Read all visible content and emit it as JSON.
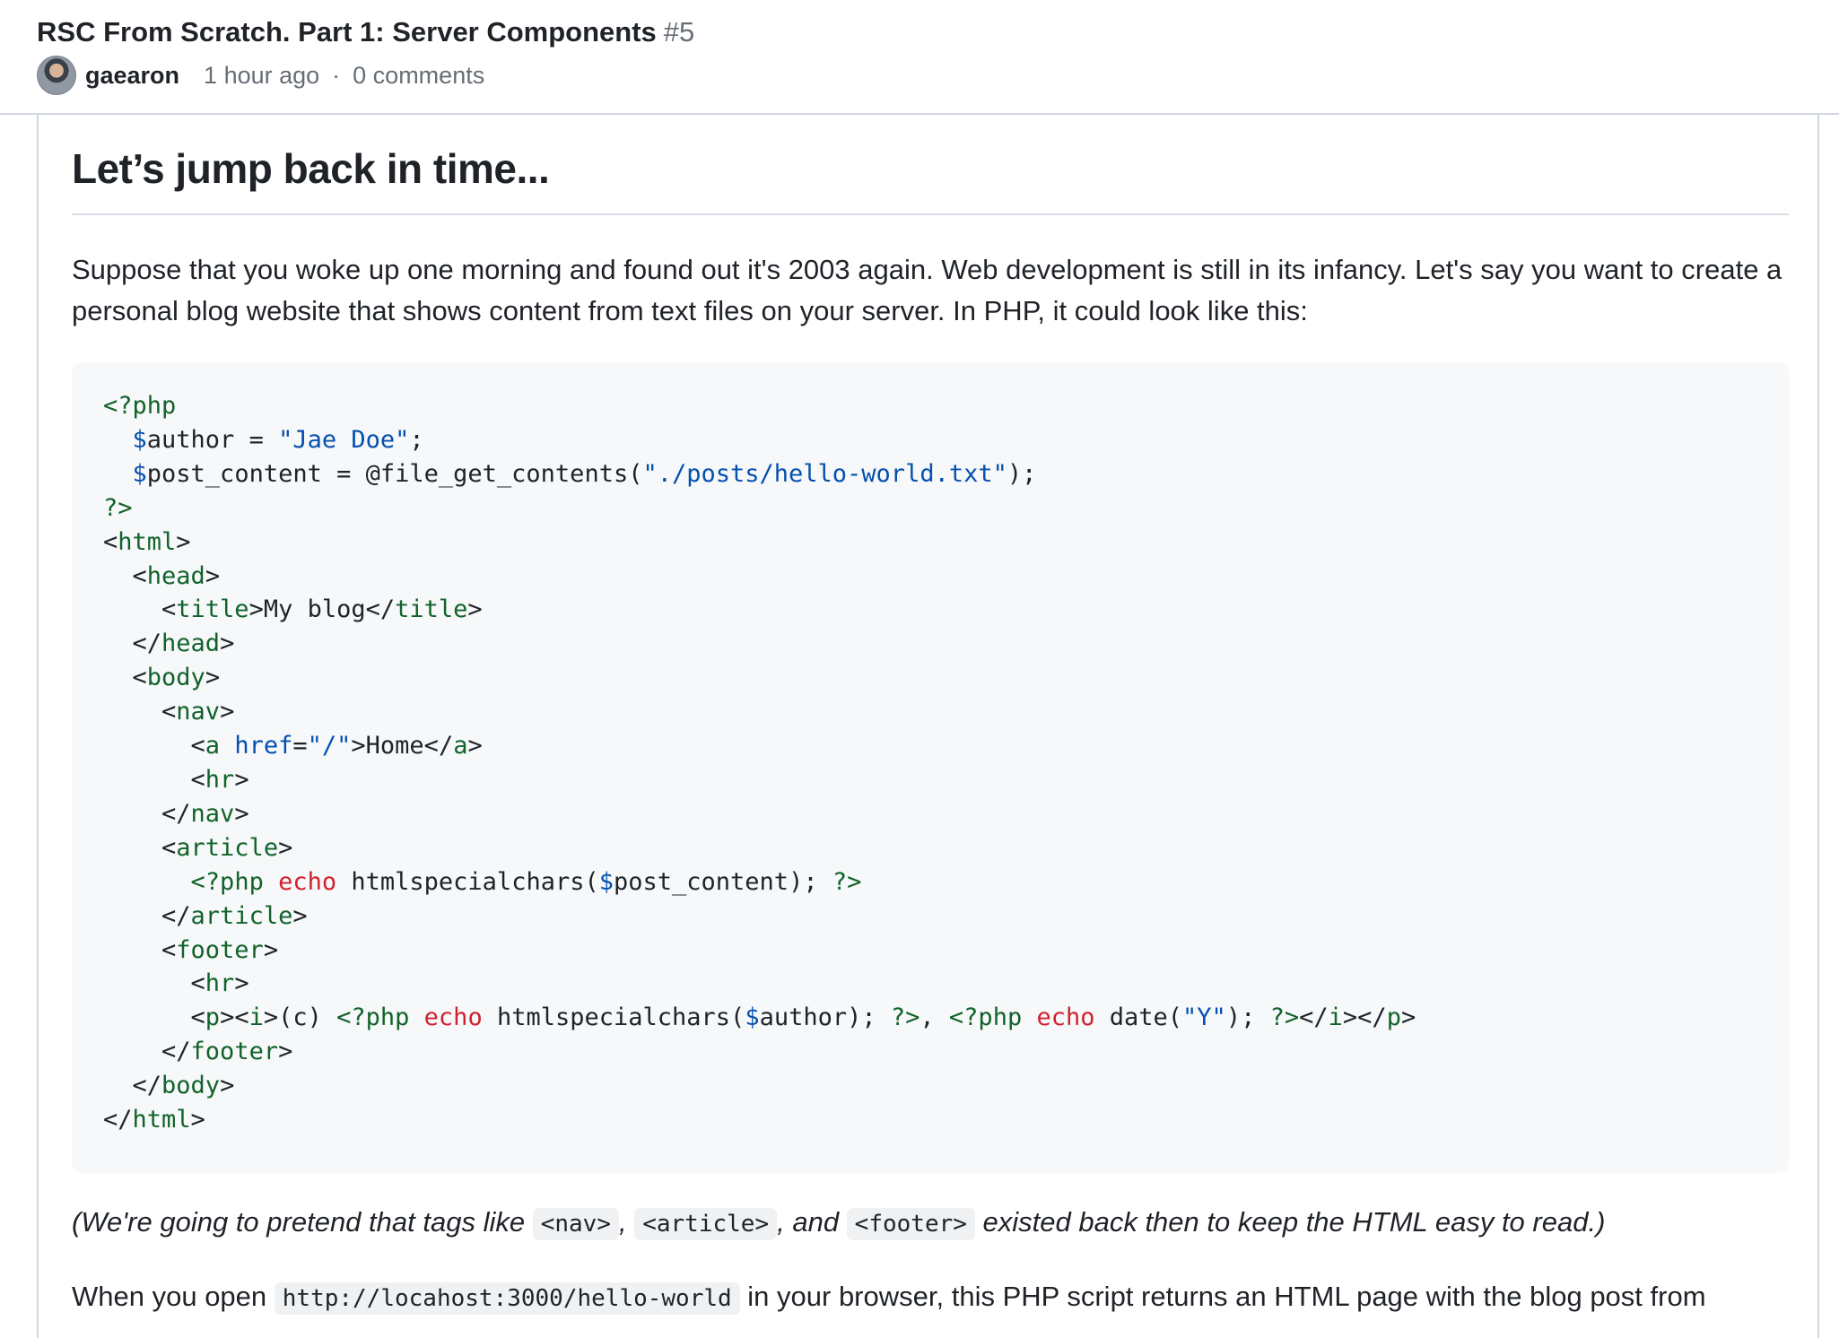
{
  "discussion": {
    "title": "RSC From Scratch. Part 1: Server Components",
    "number": "#5",
    "author": "gaearon",
    "time": "1 hour ago",
    "separator": "·",
    "comments": "0 comments"
  },
  "article": {
    "heading": "Let’s jump back in time...",
    "intro": "Suppose that you woke up one morning and found out it's 2003 again. Web development is still in its infancy. Let's say you want to create a personal blog website that shows content from text files on your server. In PHP, it could look like this:",
    "code_language": "php",
    "note": {
      "before": "(We're going to pretend that tags like ",
      "tag1": "<nav>",
      "sep1": ", ",
      "tag2": "<article>",
      "sep2": ", and ",
      "tag3": "<footer>",
      "after": " existed back then to keep the HTML easy to read.)"
    },
    "next": {
      "before": "When you open ",
      "url": "http://locahost:3000/hello-world",
      "after": " in your browser, this PHP script returns an HTML page with the blog post from"
    }
  }
}
